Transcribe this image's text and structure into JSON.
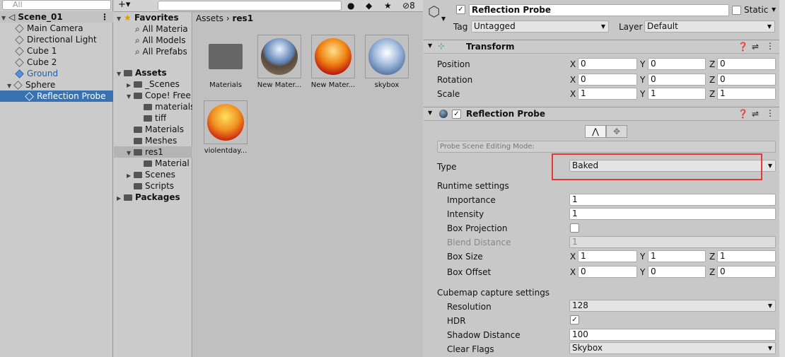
{
  "hierarchy": {
    "search_placeholder": "All",
    "scene": "Scene_01",
    "items": [
      "Main Camera",
      "Directional Light",
      "Cube 1",
      "Cube 2",
      "Ground",
      "Sphere",
      "Reflection Probe"
    ]
  },
  "project": {
    "counter": "8",
    "breadcrumb": [
      "Assets",
      "res1"
    ],
    "favorites": {
      "title": "Favorites",
      "items": [
        "All Materia",
        "All Models",
        "All Prefabs"
      ]
    },
    "assets": {
      "title": "Assets",
      "items": [
        "_Scenes",
        "Cope! Free",
        "materials",
        "tiff",
        "Materials",
        "Meshes",
        "res1",
        "Material",
        "Scenes",
        "Scripts"
      ]
    },
    "packages": "Packages",
    "tiles": [
      "Materials",
      "New Mater...",
      "New Mater...",
      "skybox",
      "violentday..."
    ]
  },
  "inspector": {
    "object_name": "Reflection Probe",
    "static_label": "Static",
    "tag_label": "Tag",
    "tag_value": "Untagged",
    "layer_label": "Layer",
    "layer_value": "Default",
    "transform": {
      "title": "Transform",
      "position_label": "Position",
      "rotation_label": "Rotation",
      "scale_label": "Scale",
      "position": [
        "0",
        "0",
        "0"
      ],
      "rotation": [
        "0",
        "0",
        "0"
      ],
      "scale": [
        "1",
        "1",
        "1"
      ]
    },
    "probe": {
      "title": "Reflection Probe",
      "editing_mode": "Probe Scene Editing Mode:",
      "type_label": "Type",
      "type_value": "Baked",
      "runtime_label": "Runtime settings",
      "importance_label": "Importance",
      "importance": "1",
      "intensity_label": "Intensity",
      "intensity": "1",
      "box_projection_label": "Box Projection",
      "blend_distance_label": "Blend Distance",
      "blend_distance": "1",
      "box_size_label": "Box Size",
      "box_size": [
        "1",
        "1",
        "1"
      ],
      "box_offset_label": "Box Offset",
      "box_offset": [
        "0",
        "0",
        "0"
      ],
      "cubemap_label": "Cubemap capture settings",
      "resolution_label": "Resolution",
      "resolution": "128",
      "hdr_label": "HDR",
      "shadow_distance_label": "Shadow Distance",
      "shadow_distance": "100",
      "clear_flags_label": "Clear Flags",
      "clear_flags": "Skybox"
    },
    "axis": [
      "X",
      "Y",
      "Z"
    ]
  },
  "colors": {
    "selection": "#3a72b0",
    "highlight_box": "#e53935",
    "ground_text": "#1f5fb0"
  }
}
